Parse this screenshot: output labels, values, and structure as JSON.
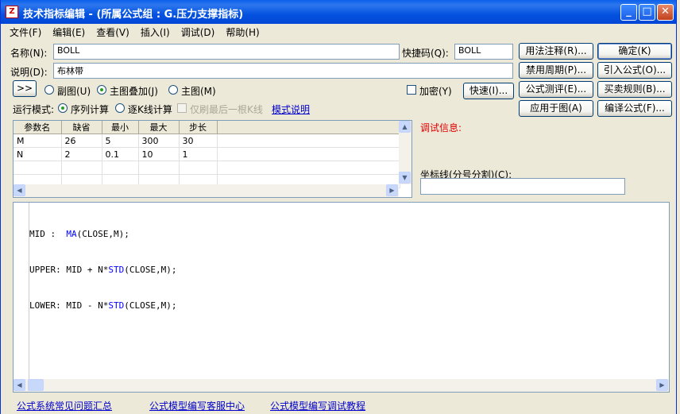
{
  "window": {
    "title": "技术指标编辑 - (所属公式组 : G.压力支撑指标)",
    "app_icon": "Z"
  },
  "menu": [
    "文件(F)",
    "编辑(E)",
    "查看(V)",
    "插入(I)",
    "调试(D)",
    "帮助(H)"
  ],
  "form": {
    "name_label": "名称(N):",
    "name_value": "BOLL",
    "shortcut_label": "快捷码(Q):",
    "shortcut_value": "BOLL",
    "desc_label": "说明(D):",
    "desc_value": "布林带",
    "expand_label": ">>",
    "radio_sub": "副图(U)",
    "radio_main_overlay": "主图叠加(J)",
    "radio_main": "主图(M)",
    "encrypt_label": "加密(Y)",
    "fast_button": "快速(I)...",
    "run_mode_label": "运行模式:",
    "run_seq": "序列计算",
    "run_kline": "逐K线计算",
    "only_last": "仅刷最后一根K线",
    "mode_desc_link": "模式说明"
  },
  "buttons": {
    "usage": "用法注释(R)...",
    "ok": "确定(K)",
    "disable_period": "禁用周期(P)...",
    "import": "引入公式(O)...",
    "test": "公式测评(E)...",
    "trade_rules": "买卖规则(B)...",
    "apply": "应用于图(A)",
    "compile": "编译公式(F)..."
  },
  "params": {
    "headers": [
      "参数名",
      "缺省",
      "最小",
      "最大",
      "步长"
    ],
    "rows": [
      [
        "M",
        "26",
        "5",
        "300",
        "30"
      ],
      [
        "N",
        "2",
        "0.1",
        "10",
        "1"
      ],
      [
        "",
        "",
        "",
        "",
        ""
      ],
      [
        "",
        "",
        "",
        "",
        ""
      ]
    ]
  },
  "debug": {
    "label": "调试信息:",
    "coord_label": "坐标线(分号分割)(C):",
    "coord_value": ""
  },
  "code_lines": [
    {
      "a": "MID :  ",
      "f": "MA",
      "b": "(CLOSE,M);"
    },
    {
      "a": "UPPER: MID + N*",
      "f": "STD",
      "b": "(CLOSE,M);"
    },
    {
      "a": "LOWER: MID - N*",
      "f": "STD",
      "b": "(CLOSE,M);"
    }
  ],
  "footer": [
    "公式系统常见问题汇总",
    "公式模型编写客服中心",
    "公式模型编写调试教程"
  ]
}
